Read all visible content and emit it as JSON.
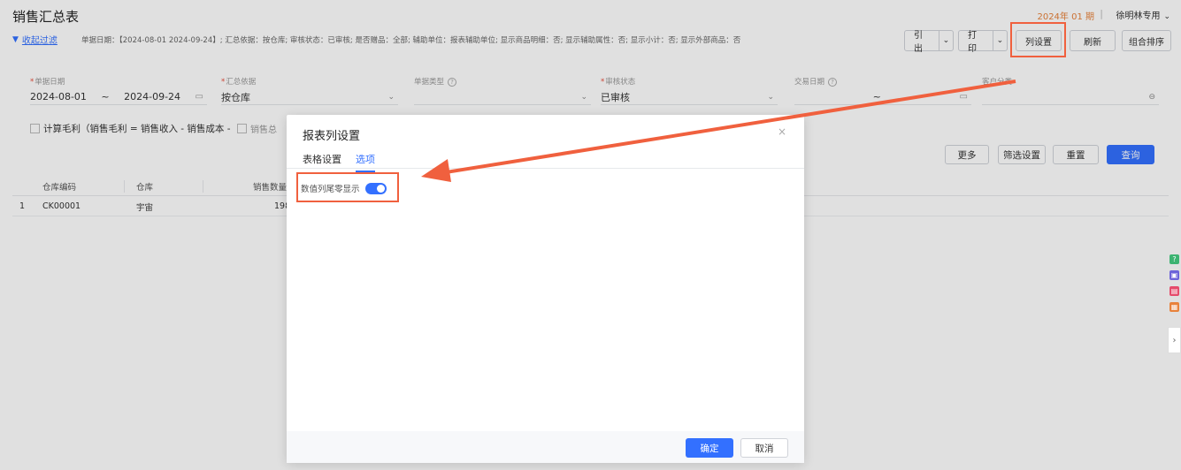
{
  "header": {
    "title": "销售汇总表",
    "period": "2024年 01 期",
    "separator": "|",
    "user": "徐明林专用"
  },
  "toolbar": {
    "collapse_filter": "收起过滤",
    "summary": "单据日期：【2024-08-01 2024-09-24】; 汇总依据：按仓库; 审核状态：已审核; 是否赠品：全部; 辅助单位：报表辅助单位; 显示商品明细：否; 显示辅助属性：否; 显示小计：否; 显示外部商品：否",
    "export_label": "引出",
    "print_label": "打印",
    "column_settings_label": "列设置",
    "refresh_label": "刷新",
    "group_sort_label": "组合排序"
  },
  "filters": {
    "doc_date": {
      "label": "单据日期",
      "start": "2024-08-01",
      "tilde": "~",
      "end": "2024-09-24"
    },
    "summary_basis": {
      "label": "汇总依据",
      "value": "按仓库"
    },
    "doc_type": {
      "label": "单据类型",
      "value": ""
    },
    "audit_status": {
      "label": "审核状态",
      "value": "已审核"
    },
    "trade_date": {
      "label": "交易日期",
      "value": "~"
    },
    "customer_class": {
      "label": "客户分类",
      "value": ""
    },
    "gross_profit_check": "计算毛利（销售毛利 = 销售收入 - 销售成本 -",
    "sales_total_check": "销售总"
  },
  "filter_buttons": {
    "more": "更多",
    "filter_settings": "筛选设置",
    "reset": "重置",
    "query": "查询"
  },
  "table": {
    "headers": [
      "仓库编码",
      "仓库",
      "销售数量"
    ],
    "rows": [
      {
        "index": "1",
        "code": "CK00001",
        "name": "宇宙",
        "qty": "198"
      }
    ]
  },
  "modal": {
    "title": "报表列设置",
    "close": "×",
    "tabs": [
      "表格设置",
      "选项"
    ],
    "active_tab": 1,
    "option_label": "数值列尾零显示",
    "option_on": true,
    "ok": "确定",
    "cancel": "取消"
  },
  "colors": {
    "accent": "#3370ff",
    "highlight": "#f0603e",
    "period": "#e8823b"
  }
}
